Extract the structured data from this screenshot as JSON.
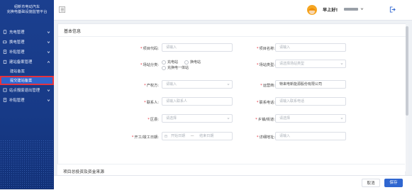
{
  "sidebar": {
    "brand_line1": "绍新市电动汽车",
    "brand_line2": "充换电基础设施监管平台",
    "items": [
      {
        "label": "充电管理"
      },
      {
        "label": "换电管理"
      },
      {
        "label": "补贴管理"
      },
      {
        "label": "建站备案管理"
      },
      {
        "label": "站点报废退出管理"
      },
      {
        "label": "补贴管理"
      }
    ],
    "sub_items": [
      {
        "label": "建站备案"
      },
      {
        "label": "提交建站备案"
      }
    ]
  },
  "topbar": {
    "greeting": "早上好!"
  },
  "form": {
    "section_title": "基本信息",
    "project_code": {
      "label": "项目代码:",
      "placeholder": "请输入"
    },
    "project_name": {
      "label": "项目名称:",
      "placeholder": "请输入"
    },
    "site_category": {
      "label": "场站分类:",
      "options": [
        "充电站",
        "换电站",
        "充换电一体站"
      ]
    },
    "site_type": {
      "label": "场站类型:",
      "placeholder": "请选择场站类型"
    },
    "ownership": {
      "label": "产权方:",
      "placeholder": "请输入"
    },
    "operator": {
      "label": "运营商:",
      "value": "特来电新能源股份有限公司"
    },
    "contact": {
      "label": "联系人:",
      "placeholder": "请输入联系人"
    },
    "phone": {
      "label": "联系电话:",
      "placeholder": "请输入联系电话"
    },
    "district": {
      "label": "区县:",
      "placeholder": "请选择"
    },
    "town": {
      "label": "乡镇/街道:",
      "placeholder": "请选择"
    },
    "dates": {
      "label": "开工/竣工日期:",
      "start": "开始日期",
      "separator": "—",
      "end": "结束日期"
    },
    "address": {
      "label": "详细地址:",
      "placeholder": "请输入"
    }
  },
  "section2_title": "项目总投资及资金来源",
  "footer": {
    "cancel_label": "取消",
    "save_label": "保存"
  },
  "colors": {
    "sidebar": "#173a87",
    "accent": "#2f66d0",
    "required": "#e5323e"
  }
}
